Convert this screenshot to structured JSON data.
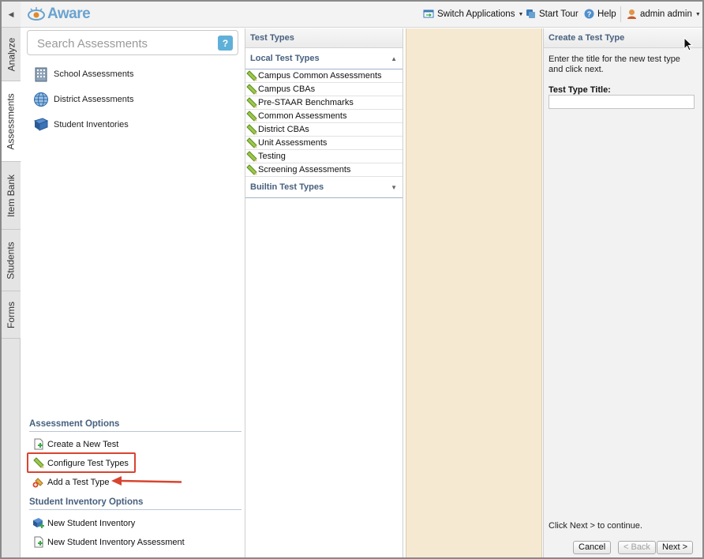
{
  "app": {
    "logo_text": "Aware"
  },
  "header": {
    "switch_apps": "Switch Applications",
    "start_tour": "Start Tour",
    "help": "Help",
    "user": "admin admin"
  },
  "vtabs": [
    "Analyze",
    "Assessments",
    "Item Bank",
    "Students",
    "Forms"
  ],
  "left": {
    "search_placeholder": "Search Assessments",
    "help_label": "?",
    "nav": [
      "School Assessments",
      "District Assessments",
      "Student Inventories"
    ],
    "assessment_options_title": "Assessment Options",
    "assessment_options": [
      "Create a New Test",
      "Configure Test Types",
      "Add a Test Type"
    ],
    "inventory_options_title": "Student Inventory Options",
    "inventory_options": [
      "New Student Inventory",
      "New Student Inventory Assessment"
    ]
  },
  "types": {
    "title": "Test Types",
    "local_title": "Local Test Types",
    "local_items": [
      "Campus Common Assessments",
      "Campus CBAs",
      "Pre-STAAR Benchmarks",
      "Common Assessments",
      "District CBAs",
      "Unit Assessments",
      "Testing",
      "Screening Assessments"
    ],
    "builtin_title": "Builtin Test Types"
  },
  "create": {
    "title": "Create a Test Type",
    "description": "Enter the title for the new test type and click next.",
    "field_label": "Test Type Title:",
    "field_value": "",
    "footer_note": "Click Next > to continue.",
    "cancel": "Cancel",
    "back": "< Back",
    "next": "Next >"
  },
  "colors": {
    "accent": "#47607f",
    "highlight": "#d9442f",
    "beige": "#f5e9d2"
  }
}
